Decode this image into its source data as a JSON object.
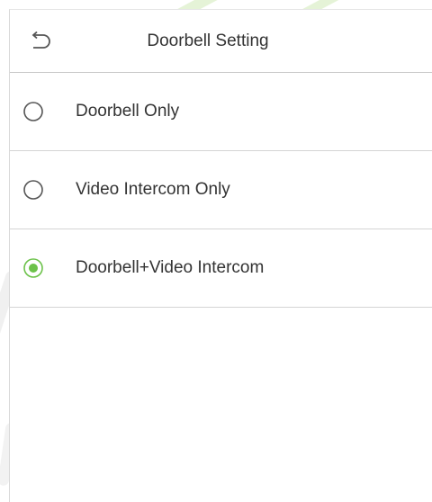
{
  "header": {
    "title": "Doorbell Setting",
    "back_icon": "back-arrow-icon"
  },
  "options": [
    {
      "label": "Doorbell Only",
      "selected": false
    },
    {
      "label": "Video Intercom Only",
      "selected": false
    },
    {
      "label": "Doorbell+Video Intercom",
      "selected": true
    }
  ],
  "colors": {
    "accent": "#6cc24a",
    "radio_border": "#555555",
    "text": "#333333",
    "divider": "#d4d4d4"
  }
}
